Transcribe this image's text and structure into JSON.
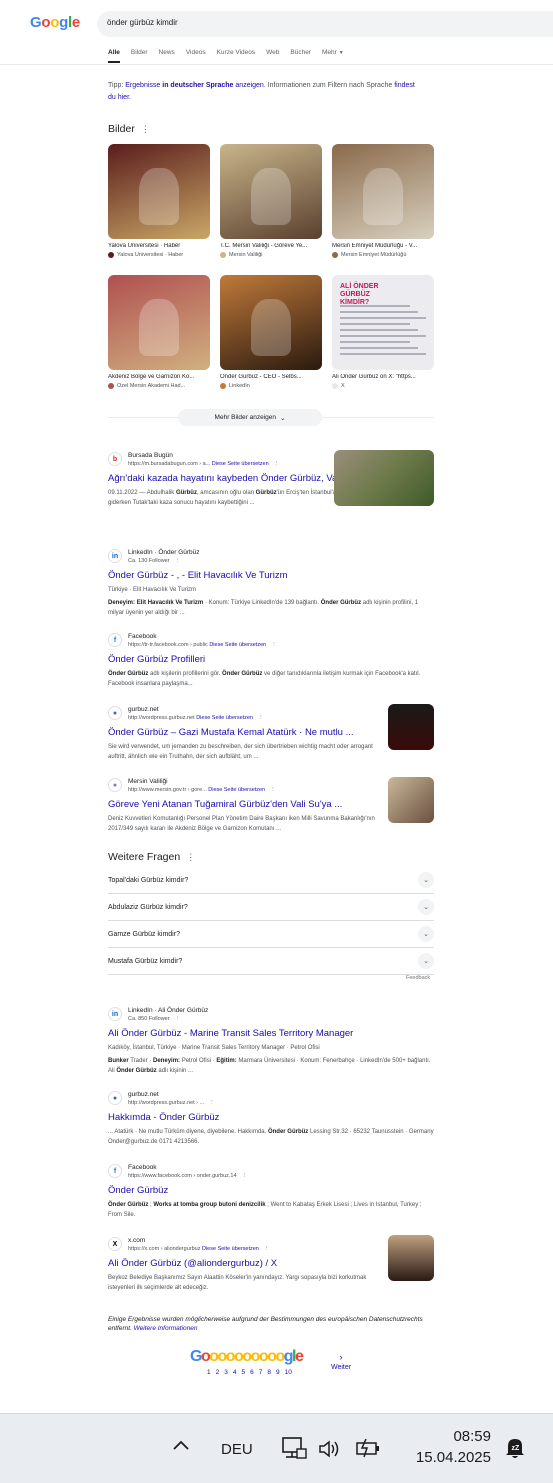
{
  "header": {
    "logo_letters": [
      "G",
      "o",
      "o",
      "g",
      "l",
      "e"
    ],
    "logo_colors": [
      "#4285f4",
      "#ea4335",
      "#fbbc05",
      "#4285f4",
      "#34a853",
      "#ea4335"
    ],
    "query": "önder gürbüz kimdir",
    "tabs": [
      "Alle",
      "Bilder",
      "News",
      "Videos",
      "Kurze Videos",
      "Web",
      "Bücher",
      "Mehr"
    ],
    "active_tab": "Alle"
  },
  "tip": {
    "prefix": "Tipp:",
    "part1": "Ergebnisse",
    "part2": "in deutscher Sprache",
    "part3": "anzeigen",
    "part4": ". Informationen zum Filtern nach Sprache",
    "part5": "findest du hier."
  },
  "images_section": {
    "title": "Bilder",
    "items": [
      {
        "title": "Yalova Üniversitesi · Haber",
        "source": "Yalova Üniversitesi · Haber",
        "colors": [
          "#5a1d1d",
          "#c9a766"
        ]
      },
      {
        "title": "T.C. Mersin Valiliği - Göreve Ye...",
        "source": "Mersin Valiliği",
        "colors": [
          "#c8b58a",
          "#5a4030"
        ]
      },
      {
        "title": "Mersin Emniyet Müdürlüğü - V...",
        "source": "Mersin Emniyet Müdürlüğü",
        "colors": [
          "#8a6a4a",
          "#d8d0c0"
        ]
      },
      {
        "title": "Akdeniz Bölge ve Garnizon Ko...",
        "source": "Özel Mersin Akademi Had...",
        "colors": [
          "#b05050",
          "#d0b080"
        ]
      },
      {
        "title": "Önder Gürbüz - CEO - Selbs...",
        "source": "LinkedIn",
        "colors": [
          "#c07a3a",
          "#2a1a10"
        ]
      },
      {
        "title": "Ali Önder Gürbüz on X: \"https...",
        "source": "X",
        "colors": [
          "#e8e8ec",
          "#9a9aa8"
        ]
      }
    ],
    "xtile_heading": "ALİ ÖNDER GÜRBÜZ KİMDİR?",
    "more_button": "Mehr Bilder anzeigen"
  },
  "results": [
    {
      "site": "Bursada Bugün",
      "url": "https://m.bursadabugun.com › a...",
      "translate": "Diese Seite übersetzen",
      "title": "Ağrı'daki kazada hayatını kaybeden Önder Gürbüz, Van'da ...",
      "snippet": "09.11.2022 — Abdulhalik Gürbüz, amcasının oğlu olan Gürbüz'ün Erciş'ten İstanbul'a çalışmak için giderken Tutak'taki kaza sonucu hayatını kaybettiğini ...",
      "fav_letter": "b",
      "fav_color": "#d32f2f"
    },
    {
      "site": "LinkedIn · Önder Gürbüz",
      "url": "Ca. 130 Follower",
      "title": "Önder Gürbüz - , - Elit Havacılık Ve Turizm",
      "meta": "Türkiye · Elit Havacılık Ve Turizm",
      "snippet": "Deneyim: Elit Havacılık Ve Turizm · Konum: Türkiye LinkedIn'de 139 bağlantı. Önder Gürbüz adlı kişinin profilini, 1 milyar üyenin yer aldığı bir ...",
      "fav_letter": "in",
      "fav_color": "#0a66c2"
    },
    {
      "site": "Facebook",
      "url": "https://tr-tr.facebook.com › public",
      "translate": "Diese Seite übersetzen",
      "title": "Önder Gürbüz Profilleri",
      "snippet": "Önder Gürbüz adlı kişilerin profillerini gör. Önder Gürbüz ve diğer tanıdıklarınla iletişim kurmak için Facebook'a katıl. Facebook insanlara paylaşma...",
      "fav_letter": "f",
      "fav_color": "#1877f2"
    },
    {
      "site": "gurbuz.net",
      "url": "http://wordpress.gurbuz.net",
      "translate": "Diese Seite übersetzen",
      "title": "Önder Gürbüz – Gazi Mustafa Kemal Atatürk · Ne mutlu ...",
      "snippet": "Sie wird verwendet, um jemanden zu beschreiben, der sich übertrieben wichtig macht oder arrogant auftritt, ähnlich wie ein Truthahn, der sich aufbläht, um ...",
      "fav_letter": "●",
      "fav_color": "#3367d6"
    },
    {
      "site": "Mersin Valiliği",
      "url": "http://www.mersin.gov.tr › gore...",
      "translate": "Diese Seite übersetzen",
      "title": "Göreve Yeni Atanan Tuğamiral Gürbüz'den Vali Su'ya ...",
      "snippet": "Deniz Kuvvetleri Komutanlığı Personel Plan Yönetim Daire Başkanı iken Milli Savunma Bakanlığı'nın 2017/349 sayılı kararı ile Akdeniz Bölge ve Garnizon Komutanı ...",
      "fav_letter": "●",
      "fav_color": "#8e6fd6"
    }
  ],
  "paa": {
    "title": "Weitere Fragen",
    "questions": [
      "Topal'daki Gürbüz kimdir?",
      "Abdulaziz Gürbüz kimdir?",
      "Gamze Gürbüz kimdir?",
      "Mustafa Gürbüz kimdir?"
    ],
    "feedback": "Feedback"
  },
  "results2": [
    {
      "site": "LinkedIn · Ali Önder Gürbüz",
      "url": "Ca. 850 Follower",
      "title": "Ali Önder Gürbüz - Marine Transit Sales Territory Manager",
      "meta": "Kadıköy, İstanbul, Türkiye · Marine Transit Sales Territory Manager · Petrol Ofisi",
      "snippet": "Bunker Trader · Deneyim: Petrol Ofisi · Eğitim: Marmara Üniversitesi · Konum: Fenerbahçe · LinkedIn'de 500+ bağlantı. Ali Önder Gürbüz adlı kişinin ...",
      "fav_letter": "in",
      "fav_color": "#0a66c2"
    },
    {
      "site": "gurbuz.net",
      "url": "http://wordpress.gurbuz.net › ...",
      "title": "Hakkımda - Önder Gürbüz",
      "snippet": "... Atatürk · Ne mutlu Türküm diyene, diyebilene. Hakkımda. Önder Gürbüz Lessing Str.32 · 65232 Taunusstein · Germany Onder@gurbuz.de 0171 4213566.",
      "fav_letter": "●",
      "fav_color": "#3367d6"
    },
    {
      "site": "Facebook",
      "url": "https://www.facebook.com › onder.gurbuz.14",
      "title": "Önder Gürbüz",
      "snippet": "Önder Gürbüz ; Works at tomba group butoni denizcilik ; Went to Kabataş Erkek Lisesi ; Lives in Istanbul, Turkey ; From Sile.",
      "fav_letter": "f",
      "fav_color": "#1877f2"
    },
    {
      "site": "x.com",
      "url": "https://x.com › aliondergurbuz",
      "translate": "Diese Seite übersetzen",
      "title": "Ali Önder Gürbüz (@aliondergurbuz) / X",
      "snippet": "Beykoz Belediye Başkanımız Sayın Alaattin Köseler'in yanındayız. Yargı sopasıyla bizi korkutmak isteyenleri ilk seçimlerde alt edeceğiz.",
      "fav_letter": "X",
      "fav_color": "#000000"
    }
  ],
  "disclaimer": {
    "text": "Einige Ergebnisse wurden möglicherweise aufgrund der Bestimmungen des europäischen Datenschutzrechts entfernt.",
    "link": "Weitere Informationen"
  },
  "pagination": {
    "logo": "Goooooooooogle",
    "pages": [
      "1",
      "2",
      "3",
      "4",
      "5",
      "6",
      "7",
      "8",
      "9",
      "10"
    ],
    "next": "Weiter"
  },
  "taskbar": {
    "language": "DEU",
    "time": "08:59",
    "date": "15.04.2025"
  }
}
